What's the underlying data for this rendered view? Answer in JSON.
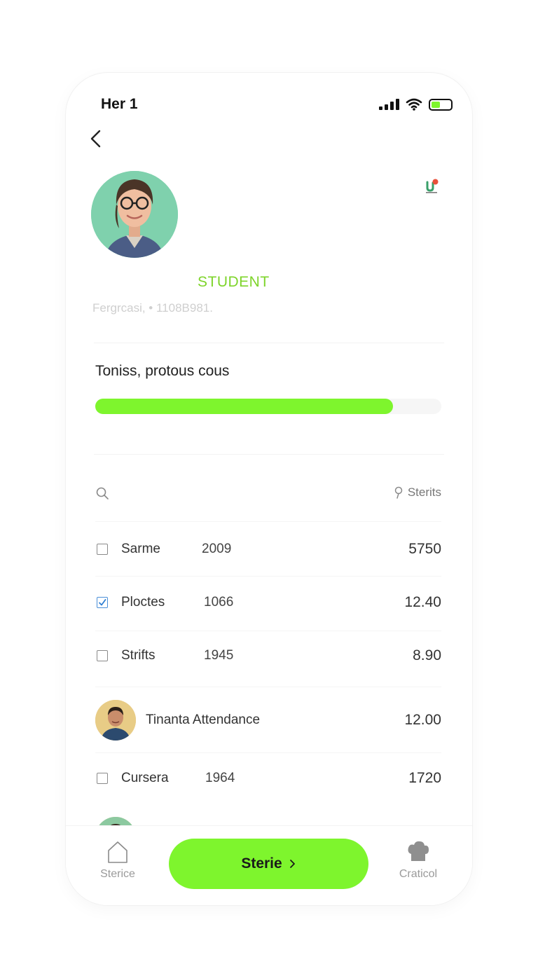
{
  "status_bar": {
    "time": "Her 1"
  },
  "profile": {
    "role": "STUDENT",
    "meta": "Fergrcasi,  •  1108B981."
  },
  "progress": {
    "title": "Toniss, protous cous",
    "fraction": 0.86
  },
  "list_header": {
    "filter_label": "Sterits"
  },
  "rows": [
    {
      "name": "Sarme",
      "year": "2009",
      "value": "5750",
      "checked": false
    },
    {
      "name": "Ploctes",
      "year": "1066",
      "value": "12.40",
      "checked": true
    },
    {
      "name": "Strifts",
      "year": "1945",
      "value": "8.90",
      "checked": false
    },
    {
      "name": "Tinanta Attendance",
      "value": "12.00"
    },
    {
      "name": "Cursera",
      "year": "1964",
      "value": "1720",
      "checked": false
    }
  ],
  "bottom_nav": {
    "home_label": "Sterice",
    "primary_button": "Sterie",
    "right_label": "Craticol"
  },
  "colors": {
    "accent": "#7ef52d",
    "role_text": "#7ed42b"
  }
}
